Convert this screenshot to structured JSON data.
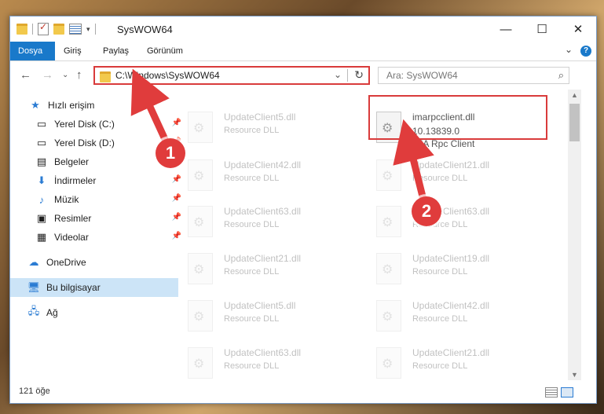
{
  "window": {
    "title": "SysWOW64",
    "controls": {
      "minimize": "—",
      "maximize": "☐",
      "close": "✕"
    }
  },
  "ribbon": {
    "tabs": [
      "Dosya",
      "Giriş",
      "Paylaş",
      "Görünüm"
    ],
    "help": "?"
  },
  "address": {
    "path": "C:\\Windows\\SysWOW64",
    "search_placeholder": "Ara: SysWOW64"
  },
  "sidebar": {
    "items": [
      {
        "label": "Hızlı erişim",
        "icon": "star-icon"
      },
      {
        "label": "Yerel Disk (C:)",
        "icon": "drive-icon"
      },
      {
        "label": "Yerel Disk (D:)",
        "icon": "drive-icon"
      },
      {
        "label": "Belgeler",
        "icon": "document-icon"
      },
      {
        "label": "İndirmeler",
        "icon": "download-arrow-icon"
      },
      {
        "label": "Müzik",
        "icon": "music-note-icon"
      },
      {
        "label": "Resimler",
        "icon": "pictures-icon"
      },
      {
        "label": "Videolar",
        "icon": "video-icon"
      },
      {
        "label": "OneDrive",
        "icon": "cloud-icon"
      },
      {
        "label": "Bu bilgisayar",
        "icon": "computer-icon"
      },
      {
        "label": "Ağ",
        "icon": "network-icon"
      }
    ]
  },
  "files": {
    "highlighted": {
      "name": "imarpcclient.dll",
      "version": "10.13839.0",
      "company": "IMA Rpc Client"
    },
    "left": [
      {
        "name": "UpdateClient5.dll",
        "type": "Resource DLL"
      },
      {
        "name": "UpdateClient42.dll",
        "type": "Resource DLL"
      },
      {
        "name": "UpdateClient63.dll",
        "type": "Resource DLL"
      },
      {
        "name": "UpdateClient21.dll",
        "type": "Resource DLL"
      },
      {
        "name": "UpdateClient5.dll",
        "type": "Resource DLL"
      },
      {
        "name": "UpdateClient63.dll",
        "type": "Resource DLL"
      }
    ],
    "right": [
      {
        "name": "UpdateClient21.dll",
        "type": "Resource DLL"
      },
      {
        "name": "UpdateClient63.dll",
        "type": "Resource DLL"
      },
      {
        "name": "UpdateClient19.dll",
        "type": "Resource DLL"
      },
      {
        "name": "UpdateClient42.dll",
        "type": "Resource DLL"
      },
      {
        "name": "UpdateClient21.dll",
        "type": "Resource DLL"
      }
    ]
  },
  "status": {
    "item_count": "121 öğe"
  },
  "annotations": {
    "step1": "1",
    "step2": "2"
  },
  "colors": {
    "accent": "#1979ca",
    "highlight": "#d93b3b"
  }
}
